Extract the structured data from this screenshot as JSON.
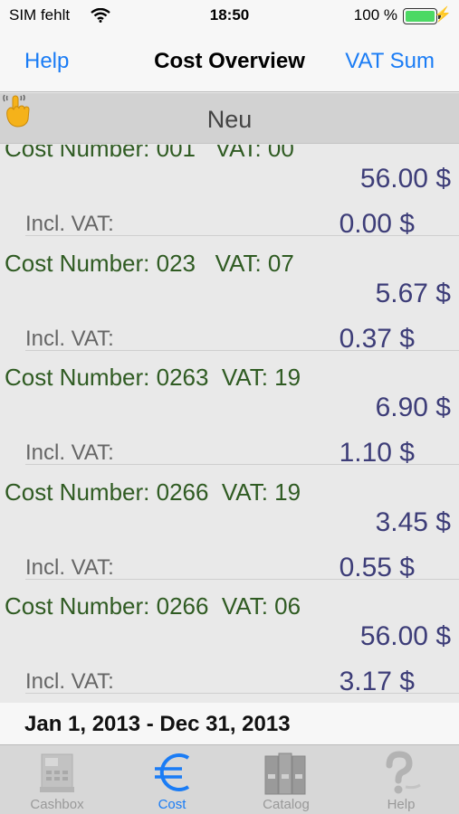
{
  "status_bar": {
    "carrier": "SIM fehlt",
    "time": "18:50",
    "battery_pct": "100 %"
  },
  "nav": {
    "left_button": "Help",
    "title": "Cost Overview",
    "right_button": "VAT Sum"
  },
  "toolbar": {
    "new_label": "Neu",
    "hand_icon": "tap-hand-icon"
  },
  "entries": [
    {
      "cost_line": "Cost Number: 001   VAT: 00",
      "amount": "56.00 $",
      "incl_label": "Incl. VAT:",
      "incl_value": "0.00 $"
    },
    {
      "cost_line": "Cost Number: 023   VAT: 07",
      "amount": "5.67 $",
      "incl_label": "Incl. VAT:",
      "incl_value": "0.37 $"
    },
    {
      "cost_line": "Cost Number: 0263  VAT: 19",
      "amount": "6.90 $",
      "incl_label": "Incl. VAT:",
      "incl_value": "1.10 $"
    },
    {
      "cost_line": "Cost Number: 0266  VAT: 19",
      "amount": "3.45 $",
      "incl_label": "Incl. VAT:",
      "incl_value": "0.55 $"
    },
    {
      "cost_line": "Cost Number: 0266  VAT: 06",
      "amount": "56.00 $",
      "incl_label": "Incl. VAT:",
      "incl_value": "3.17 $"
    }
  ],
  "date_range": "Jan 1, 2013 - Dec 31, 2013",
  "tabs": [
    {
      "label": "Cashbox",
      "icon": "cash-register-icon",
      "active": false
    },
    {
      "label": "Cost",
      "icon": "euro-icon",
      "active": true
    },
    {
      "label": "Catalog",
      "icon": "binders-icon",
      "active": false
    },
    {
      "label": "Help",
      "icon": "question-mark-icon",
      "active": false
    }
  ],
  "colors": {
    "accent": "#1a7cf5",
    "cost_line": "#2f5b22",
    "amount": "#3d3d78"
  }
}
